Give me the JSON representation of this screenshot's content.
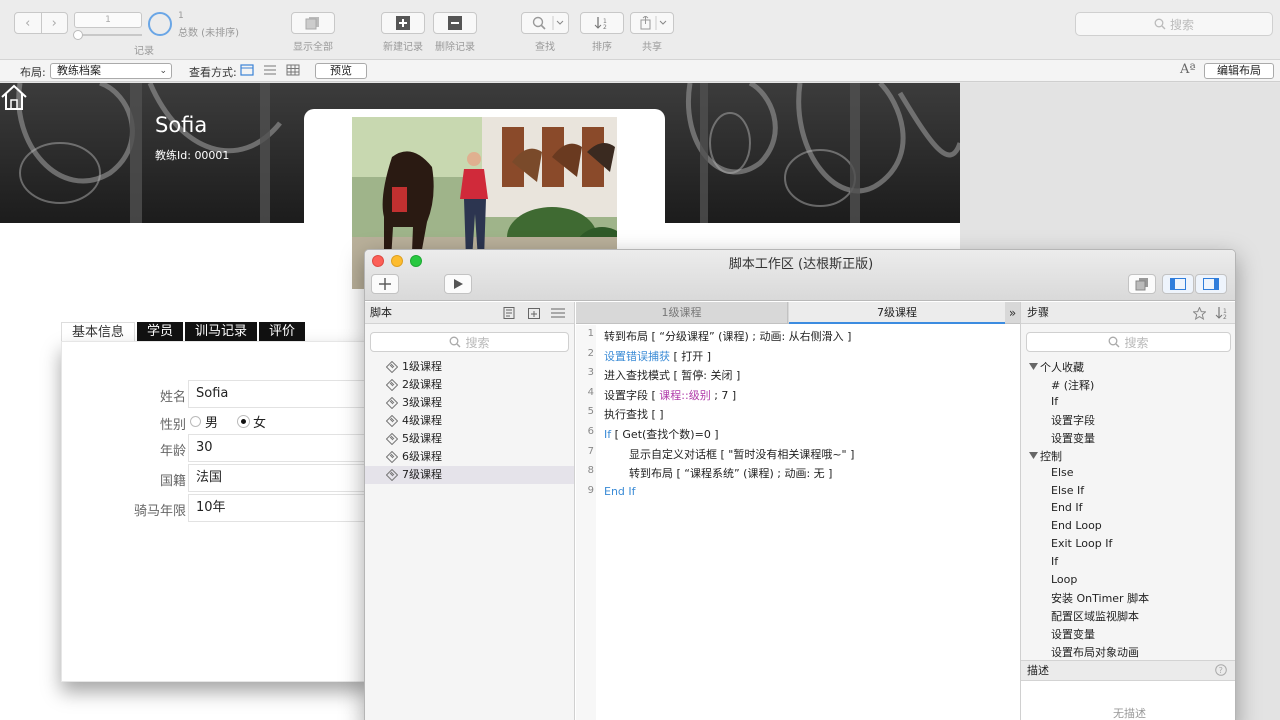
{
  "toolbar": {
    "record_input_value": "1",
    "record_caption": "记录",
    "total_count": "1",
    "total_label": "总数 (未排序)",
    "show_all_label": "显示全部",
    "new_record_label": "新建记录",
    "delete_record_label": "删除记录",
    "find_label": "查找",
    "sort_label": "排序",
    "share_label": "共享",
    "search_placeholder": "搜索"
  },
  "layoutbar": {
    "layout_label": "布局:",
    "layout_value": "教练档案",
    "view_as_label": "查看方式:",
    "preview_label": "预览",
    "edit_layout_label": "编辑布局",
    "text_size_icon": "Aª"
  },
  "record": {
    "coach_name": "Sofia",
    "coach_id_label": "教练Id:",
    "coach_id": "00001",
    "tabs": [
      "基本信息",
      "学员",
      "训马记录",
      "评价"
    ],
    "fields": {
      "name_label": "姓名",
      "name_value": "Sofia",
      "gender_label": "性别",
      "gender_male": "男",
      "gender_female": "女",
      "gender_selected": "女",
      "age_label": "年龄",
      "age_value": "30",
      "nationality_label": "国籍",
      "nationality_value": "法国",
      "riding_years_label": "骑马年限",
      "riding_years_value": "10年"
    }
  },
  "script_workspace": {
    "title": "脚本工作区 (达根斯正版)",
    "scripts_header": "脚本",
    "search_placeholder": "搜索",
    "scripts": [
      "1级课程",
      "2级课程",
      "3级课程",
      "4级课程",
      "5级课程",
      "6级课程",
      "7级课程"
    ],
    "selected_script": "7级课程",
    "editor_tabs": [
      "1级课程",
      "7级课程"
    ],
    "active_tab": "7级课程",
    "overflow_icon": "»",
    "code_lines": [
      {
        "num": "1",
        "text": "转到布局 [ “分级课程” (课程) ; 动画: 从右侧滑入 ]"
      },
      {
        "num": "2",
        "kw": "设置错误捕获",
        "text": " [ 打开 ]"
      },
      {
        "num": "3",
        "text": "进入查找模式 [ 暂停: 关闭 ]"
      },
      {
        "num": "4",
        "pre": "设置字段 [ ",
        "field": "课程::级别",
        "post": " ; 7 ]"
      },
      {
        "num": "5",
        "text": "执行查找 [ ]"
      },
      {
        "num": "6",
        "kw": "If",
        "text": " [ Get(查找个数)=0 ]"
      },
      {
        "num": "7",
        "text": "显示自定义对话框 [ \"暂时没有相关课程哦~\" ]"
      },
      {
        "num": "8",
        "text": "转到布局 [ “课程系统” (课程) ; 动画: 无 ]"
      },
      {
        "num": "9",
        "kw": "End If",
        "text": ""
      }
    ],
    "steps_header": "步骤",
    "steps_search_placeholder": "搜索",
    "categories": [
      {
        "name": "个人收藏",
        "items": [
          "# (注释)",
          "If",
          "设置字段",
          "设置变量"
        ]
      },
      {
        "name": "控制",
        "items": [
          "Else",
          "Else If",
          "End If",
          "End Loop",
          "Exit Loop If",
          "If",
          "Loop",
          "安装 OnTimer 脚本",
          "配置区域监视脚本",
          "设置变量",
          "设置布局对象动画"
        ]
      }
    ],
    "description_header": "描述",
    "no_description": "无描述"
  }
}
